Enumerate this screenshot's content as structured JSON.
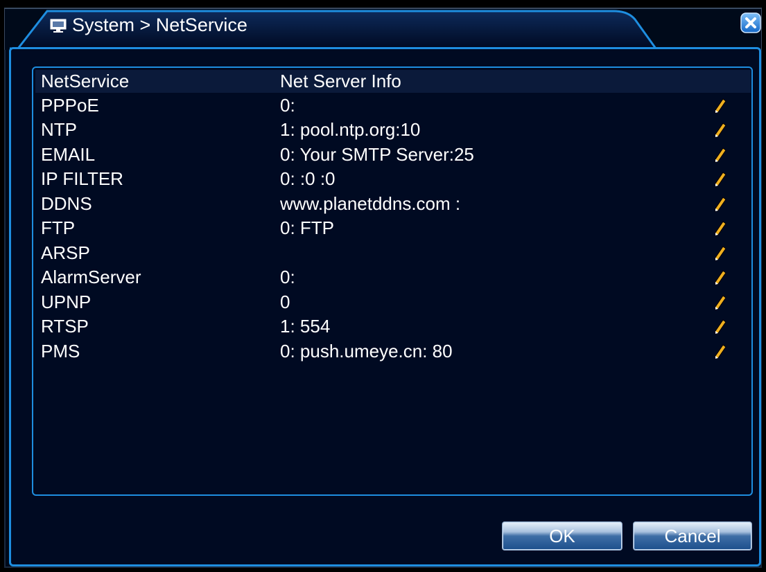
{
  "window": {
    "title": "System > NetService",
    "title_icon": "monitor-icon",
    "close_icon": "close-icon"
  },
  "list": {
    "headers": {
      "service": "NetService",
      "info": "Net Server Info"
    },
    "rows": [
      {
        "name": "PPPoE",
        "info": "0:"
      },
      {
        "name": "NTP",
        "info": "1: pool.ntp.org:10"
      },
      {
        "name": "EMAIL",
        "info": "0: Your SMTP Server:25"
      },
      {
        "name": "IP FILTER",
        "info": "0: :0 :0"
      },
      {
        "name": "DDNS",
        "info": "www.planetddns.com :"
      },
      {
        "name": "FTP",
        "info": "0: FTP"
      },
      {
        "name": "ARSP",
        "info": ""
      },
      {
        "name": "AlarmServer",
        "info": "0:"
      },
      {
        "name": "UPNP",
        "info": "0"
      },
      {
        "name": "RTSP",
        "info": "1: 554"
      },
      {
        "name": "PMS",
        "info": "0: push.umeye.cn: 80"
      }
    ],
    "edit_icon": "pencil-icon"
  },
  "buttons": {
    "ok": "OK",
    "cancel": "Cancel"
  },
  "colors": {
    "accent": "#1e8ee0",
    "background": "#000a22",
    "text": "#ffffff",
    "pencil": "#f0b020"
  }
}
